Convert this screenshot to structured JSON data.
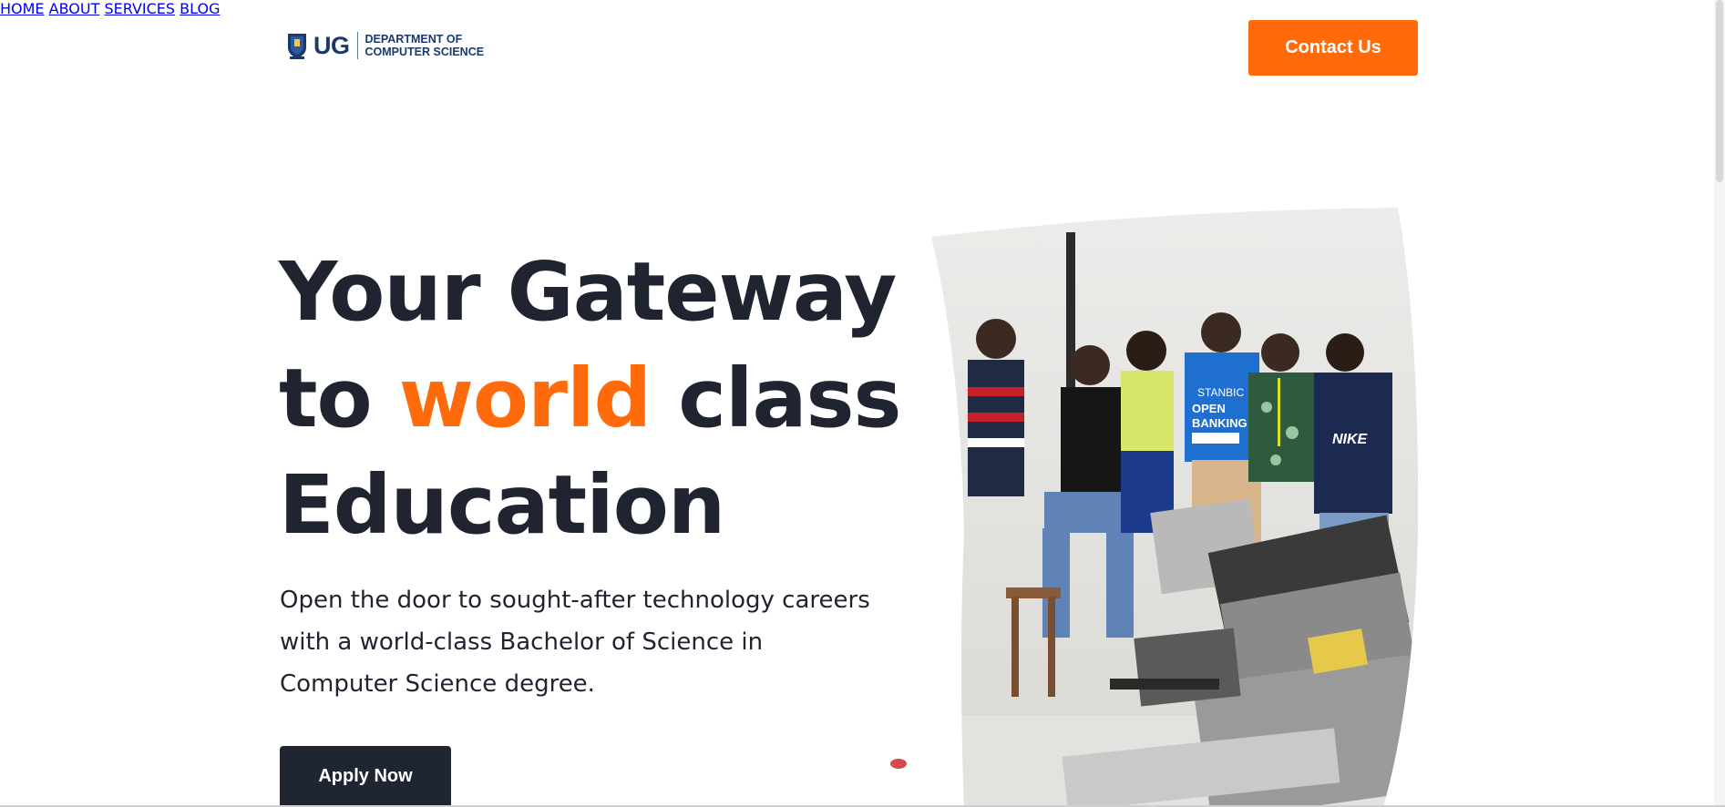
{
  "logo": {
    "short": "UG",
    "dept_line1": "DEPARTMENT OF",
    "dept_line2": "COMPUTER SCIENCE",
    "crest_icon": "university-crest-icon"
  },
  "nav": {
    "items": [
      {
        "label": "HOME"
      },
      {
        "label": "ABOUT"
      },
      {
        "label": "SERVICES"
      },
      {
        "label": "BLOG"
      }
    ],
    "contact_label": "Contact Us"
  },
  "hero": {
    "title_line1": "Your Gateway",
    "title_to": "to",
    "title_accent": "world",
    "title_class": "class",
    "title_line3": "Education",
    "subtitle_line1": "Open the door to sought-after technology careers",
    "subtitle_line2": "with a world-class Bachelor of Science in",
    "subtitle_line3": "Computer Science degree.",
    "apply_label": "Apply Now",
    "photo_alt": "students-group-photo"
  },
  "colors": {
    "accent": "#ff6a0a",
    "dark": "#1f2430",
    "brand_blue": "#1b3a6b"
  }
}
